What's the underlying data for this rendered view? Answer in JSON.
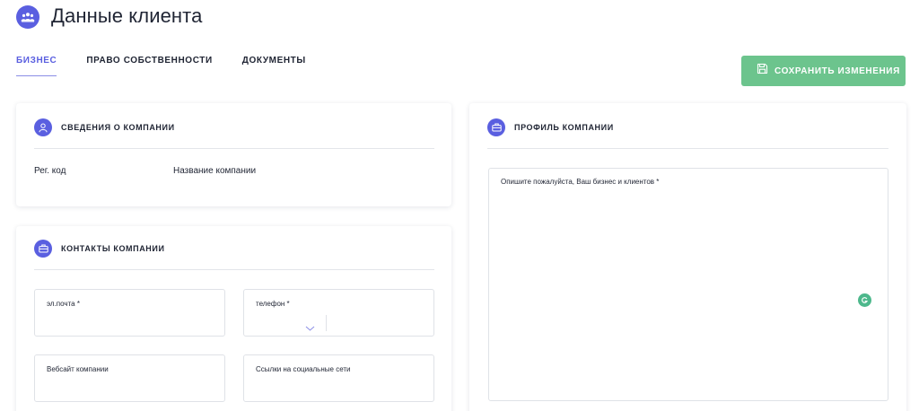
{
  "header": {
    "title": "Данные клиента",
    "icon": "team-icon"
  },
  "tabs": [
    {
      "label": "БИЗНЕС",
      "active": true
    },
    {
      "label": "ПРАВО СОБСТВЕННОСТИ",
      "active": false
    },
    {
      "label": "ДОКУМЕНТЫ",
      "active": false
    }
  ],
  "save_button": {
    "label": "СОХРАНИТЬ ИЗМЕНЕНИЯ",
    "icon": "floppy-disk-icon",
    "color": "#6cc48d"
  },
  "company_info": {
    "title": "СВЕДЕНИЯ О КОМПАНИИ",
    "icon": "user-icon",
    "reg_code_label": "Рег. код",
    "company_name_label": "Название компании"
  },
  "company_contacts": {
    "title": "КОНТАКТЫ КОМПАНИИ",
    "icon": "briefcase-icon",
    "email_label": "эл.почта *",
    "phone_label": "телефон *",
    "website_label": "Вебсайт компании",
    "social_label": "Ссылки на социальные сети"
  },
  "company_profile": {
    "title": "ПРОФИЛЬ КОМПАНИИ",
    "icon": "briefcase-icon",
    "description_label": "Опишите пожалуйста, Ваш бизнес и клиентов *"
  },
  "colors": {
    "accent": "#5a5fe0",
    "success": "#6cc48d",
    "text": "#1f2433"
  }
}
